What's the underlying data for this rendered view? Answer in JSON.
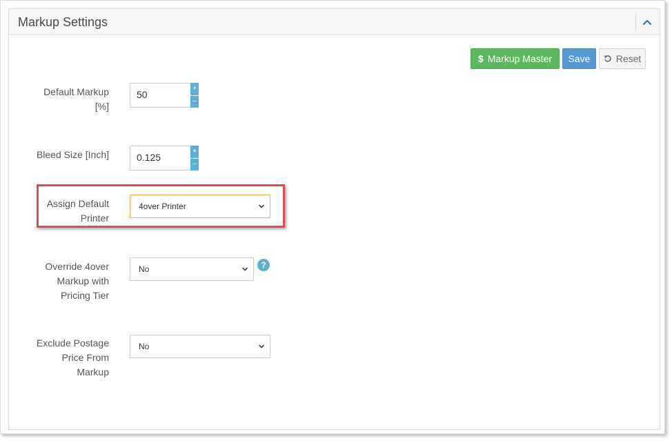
{
  "panel": {
    "title": "Markup Settings"
  },
  "toolbar": {
    "markup_master_label": "Markup Master",
    "save_label": "Save",
    "reset_label": "Reset"
  },
  "fields": {
    "default_markup": {
      "label_line1": "Default Markup",
      "label_line2": "[%]",
      "value": "50",
      "plus": "+",
      "minus": "–"
    },
    "bleed_size": {
      "label": "Bleed Size [Inch]",
      "value": "0.125",
      "plus": "+",
      "minus": "–"
    },
    "default_printer": {
      "label_line1": "Assign Default",
      "label_line2": "Printer",
      "value": "4over Printer"
    },
    "override_markup": {
      "label_line1": "Override 4over",
      "label_line2": "Markup with",
      "label_line3": "Pricing Tier",
      "value": "No",
      "help": "?"
    },
    "exclude_postage": {
      "label_line1": "Exclude Postage",
      "label_line2": "Price From",
      "label_line3": "Markup",
      "value": "No"
    }
  },
  "icons": {
    "collapse": "chevron-up-icon",
    "markup_master": "dollar-icon",
    "reset": "undo-icon",
    "select": "chevron-down-icon",
    "help": "question-icon"
  },
  "colors": {
    "green": "#5cb85c",
    "blue": "#5299d3",
    "spinner": "#5bb0d5",
    "highlight": "#e24a4e",
    "focus_border": "#f0ad4e"
  }
}
